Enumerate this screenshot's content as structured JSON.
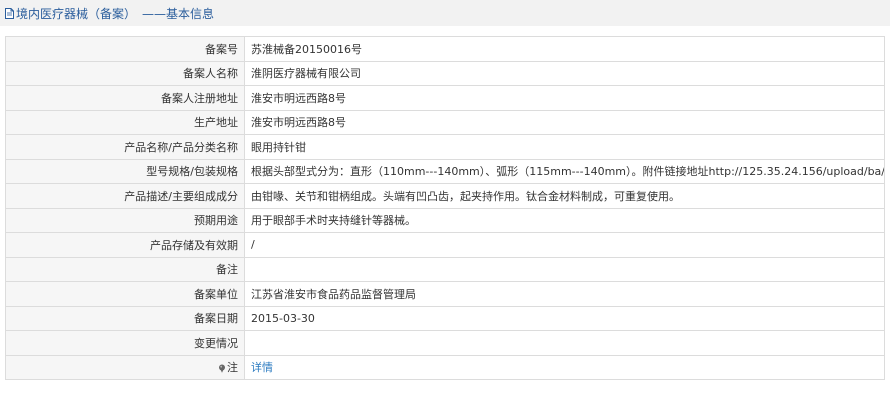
{
  "header": {
    "title": "境内医疗器械（备案）",
    "subtitle": "——基本信息"
  },
  "rows": [
    {
      "label": "备案号",
      "value": "苏淮械备20150016号"
    },
    {
      "label": "备案人名称",
      "value": "淮阴医疗器械有限公司"
    },
    {
      "label": "备案人注册地址",
      "value": "淮安市明远西路8号"
    },
    {
      "label": "生产地址",
      "value": "淮安市明远西路8号"
    },
    {
      "label": "产品名称/产品分类名称",
      "value": "眼用持针钳"
    },
    {
      "label": "型号规格/包装规格",
      "value": "根据头部型式分为：直形（110mm---140mm）、弧形（115mm---140mm）。附件链接地址http://125.35.24.156/upload/ba/"
    },
    {
      "label": "产品描述/主要组成成分",
      "value": "由钳喙、关节和钳柄组成。头端有凹凸齿，起夹持作用。钛合金材料制成，可重复使用。"
    },
    {
      "label": "预期用途",
      "value": "用于眼部手术时夹持缝针等器械。"
    },
    {
      "label": "产品存储及有效期",
      "value": "/"
    },
    {
      "label": "备注",
      "value": ""
    },
    {
      "label": "备案单位",
      "value": "江苏省淮安市食品药品监督管理局"
    },
    {
      "label": "备案日期",
      "value": "2015-03-30"
    },
    {
      "label": "变更情况",
      "value": ""
    }
  ],
  "note_row": {
    "label": "注",
    "link_text": "详情",
    "icon": "pin-icon"
  },
  "colors": {
    "header_text": "#2a5d9c",
    "header_bg": "#f2f2f2",
    "link": "#2a7ac0",
    "border": "#dcdcdc"
  }
}
